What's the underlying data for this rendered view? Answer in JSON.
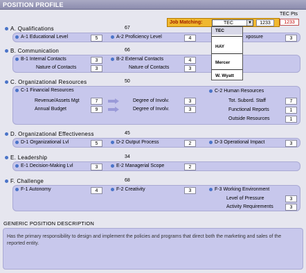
{
  "page": {
    "title": "POSITION PROFILE"
  },
  "tec_pts": {
    "label": "TEC Pts",
    "value": "1233"
  },
  "job_matching": {
    "label": "Job Matching:",
    "selected": "TEC",
    "value": "1233",
    "options": [
      "TEC",
      "HAY",
      "Mercer",
      "W. Wyatt"
    ]
  },
  "sections": {
    "A": {
      "letter": "A.",
      "name": "Qualifications",
      "score": "67"
    },
    "B": {
      "letter": "B.",
      "name": "Communication",
      "score": "66"
    },
    "C": {
      "letter": "C.",
      "name": "Organizational Resources",
      "score": "50"
    },
    "D": {
      "letter": "D.",
      "name": "Organizational Effectiveness",
      "score": "45"
    },
    "E": {
      "letter": "E.",
      "name": "Leadership",
      "score": "34"
    },
    "F": {
      "letter": "F.",
      "name": "Challenge",
      "score": "68"
    }
  },
  "fields": {
    "a1": {
      "code": "A-1",
      "label": "Educational Level",
      "value": "5"
    },
    "a2": {
      "code": "A-2",
      "label": "Proficiency Level",
      "value": "4"
    },
    "a3": {
      "label": "xposure",
      "value": "3"
    },
    "b1": {
      "code": "B-1",
      "label": "Internal Contacts",
      "value": "3"
    },
    "b1n": {
      "label": "Nature of Contacts",
      "value": "3"
    },
    "b2": {
      "code": "B-2",
      "label": "External Contacts",
      "value": "4"
    },
    "b2n": {
      "label": "Nature of Contacts",
      "value": "3"
    },
    "c1": {
      "code": "C-1",
      "label": "Financial Resources"
    },
    "c1r": {
      "label": "Revenue/Assets Mgt",
      "value": "7"
    },
    "c1b": {
      "label": "Annual Budget",
      "value": "9"
    },
    "c1ri": {
      "label": "Degree of Involv.",
      "value": "3"
    },
    "c1bi": {
      "label": "Degree of Involv.",
      "value": "3"
    },
    "c2": {
      "code": "C-2",
      "label": "Human Resources"
    },
    "c2t": {
      "label": "Tot. Subord. Staff",
      "value": "7"
    },
    "c2f": {
      "label": "Functional Reports",
      "value": "1"
    },
    "c2o": {
      "label": "Outside Resources",
      "value": "1"
    },
    "d1": {
      "code": "D-1",
      "label": "Organizational Lvl",
      "value": "5"
    },
    "d2": {
      "code": "D-2",
      "label": "Output Process",
      "value": "2"
    },
    "d3": {
      "code": "D-3",
      "label": "Operational Impact",
      "value": "3"
    },
    "e1": {
      "code": "E-1",
      "label": "Decision-Making Lvl",
      "value": "3"
    },
    "e2": {
      "code": "E-2",
      "label": "Managerial Scope",
      "value": "2"
    },
    "f1": {
      "code": "F-1",
      "label": "Autonomy",
      "value": "4"
    },
    "f2": {
      "code": "F-2",
      "label": "Creativity",
      "value": "3"
    },
    "f3": {
      "code": "F-3",
      "label": "Working Environment"
    },
    "f3p": {
      "label": "Level of Pressure",
      "value": "3"
    },
    "f3a": {
      "label": "Activity Requirements",
      "value": "3"
    }
  },
  "description": {
    "title": "GENERIC POSITION DESCRIPTION",
    "text": "Has the primary responsibility to design and implement the policies and programs that direct both the marketing and sales of the reported entity."
  }
}
